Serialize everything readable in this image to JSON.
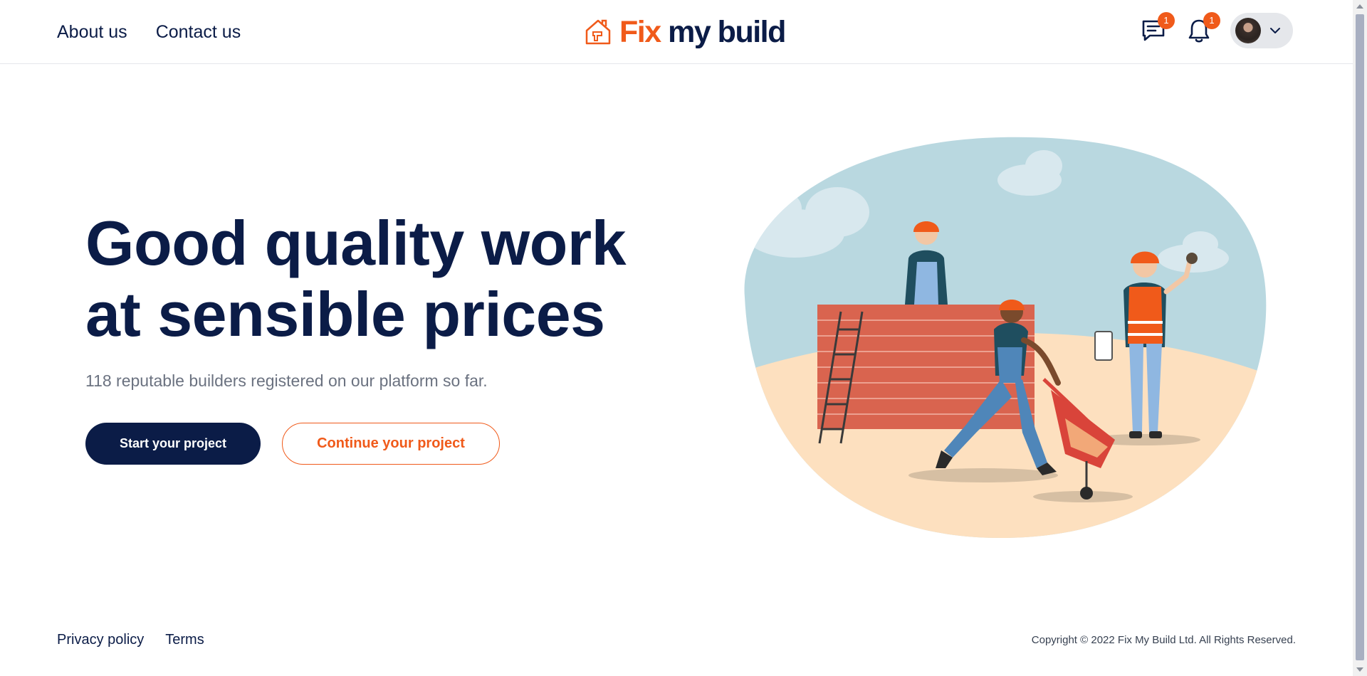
{
  "header": {
    "nav": [
      {
        "label": "About us"
      },
      {
        "label": "Contact us"
      }
    ],
    "brand": {
      "fix": "Fix",
      "rest": " my build"
    },
    "messages_badge": "1",
    "notifications_badge": "1"
  },
  "hero": {
    "title_line1": "Good quality work",
    "title_line2": "at sensible prices",
    "subtitle": "118 reputable builders registered on our platform so far.",
    "primary_button": "Start your project",
    "secondary_button": "Continue your project"
  },
  "footer": {
    "links": [
      {
        "label": "Privacy policy"
      },
      {
        "label": "Terms"
      }
    ],
    "copyright": "Copyright © 2022 Fix My Build Ltd. All Rights Reserved."
  },
  "colors": {
    "brand_navy": "#0b1c47",
    "brand_orange": "#f05a1a"
  }
}
